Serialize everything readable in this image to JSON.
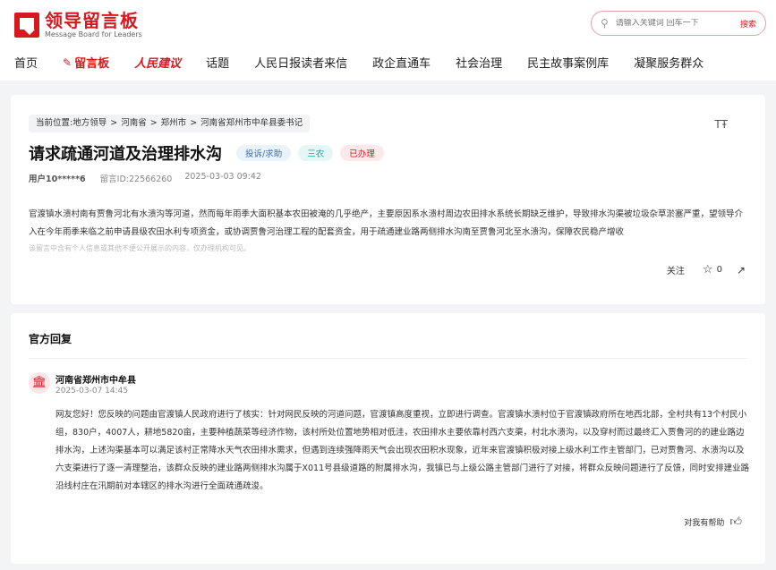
{
  "brand": {
    "name": "领导留言板",
    "subtitle": "Message Board for Leaders"
  },
  "search": {
    "placeholder": "请输入关键词 回车一下",
    "button": "搜索"
  },
  "nav": {
    "items": [
      "首页",
      "留言板",
      "人民建议",
      "话题",
      "人民日报读者来信",
      "政企直通车",
      "社会治理",
      "民主故事案例库",
      "凝聚服务群众"
    ]
  },
  "breadcrumb": {
    "prefix": "当前位置:",
    "items": [
      "地方领导",
      "河南省",
      "郑州市",
      "河南省郑州市中牟县委书记"
    ]
  },
  "message": {
    "title": "请求疏通河道及治理排水沟",
    "tags": [
      "投诉/求助",
      "三农",
      "已办理"
    ],
    "user": "用户10*****6",
    "id": "留言ID:22566260",
    "date": "2025-03-03 09:42",
    "content": "官渡镇水溃村南有贾鲁河北有水溃沟等河道，然而每年雨季大面积基本农田被淹的几乎绝产，主要原因系水溃村周边农田排水系统长期缺乏维护，导致排水沟渠被垃圾杂草淤塞严重，望领导介入在今年雨季来临之前申请县级农田水利专项资金，或协调贾鲁河治理工程的配套资金，用于疏通建业路两侧排水沟南至贾鲁河北至水溃沟，保障农民稳产增收",
    "notice": "该留言中含有个人信息或其他不便公开展示的内容，仅办理机构可见。",
    "follow": "关注",
    "likes": "0"
  },
  "reply": {
    "heading": "官方回复",
    "org": "河南省郑州市中牟县",
    "date": "2025-03-07 14:45",
    "content": "网友您好！您反映的问题由官渡镇人民政府进行了核实：针对网民反映的河道问题，官渡镇高度重视，立即进行调查。官渡镇水溃村位于官渡镇政府所在地西北部，全村共有13个村民小组，830户，4007人，耕地5820亩，主要种植蔬菜等经济作物，该村所处位置地势相对低洼，农田排水主要依靠村西六支渠，村北水溃沟，以及穿村而过最终汇入贾鲁河的的建业路边排水沟，上述沟渠基本可以满足该村正常降水天气农田排水需求，但遇到连续强降雨天气会出现农田积水现象，近年来官渡镇积极对接上级水利工作主管部门，已对贾鲁河、水溃沟以及六支渠进行了逐一清理整治，该群众反映的建业路两侧排水沟属于X011号县级道路的附属排水沟，我镇已与上级公路主管部门进行了对接，将群众反映问题进行了反馈，同时安排建业路沿线村庄在汛期前对本辖区的排水沟进行全面疏通疏浚。",
    "helpful": "对我有帮助"
  },
  "colors": {
    "brand_red": "#d7181f",
    "background": "#f3f4f6"
  }
}
